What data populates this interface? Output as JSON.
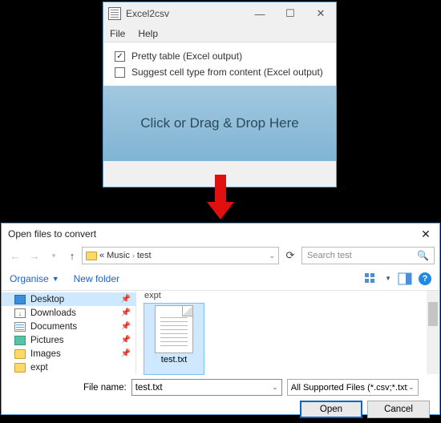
{
  "app": {
    "title": "Excel2csv",
    "menu": {
      "file": "File",
      "help": "Help"
    },
    "opts": {
      "pretty": {
        "label": "Pretty table (Excel output)",
        "checked": true
      },
      "suggest": {
        "label": "Suggest cell type from content (Excel output)",
        "checked": false
      }
    },
    "drop_zone": "Click or Drag & Drop Here"
  },
  "dialog": {
    "title": "Open files to convert",
    "path": {
      "prefix": "«",
      "seg1": "Music",
      "seg2": "test"
    },
    "search_placeholder": "Search test",
    "toolbar": {
      "organise": "Organise",
      "new_folder": "New folder"
    },
    "sidebar": [
      {
        "label": "Desktop",
        "icon": "desktop",
        "pinned": true
      },
      {
        "label": "Downloads",
        "icon": "downloads",
        "pinned": true
      },
      {
        "label": "Documents",
        "icon": "documents",
        "pinned": true
      },
      {
        "label": "Pictures",
        "icon": "pictures",
        "pinned": true
      },
      {
        "label": "Images",
        "icon": "folder",
        "pinned": true
      },
      {
        "label": "expt",
        "icon": "folder",
        "pinned": false
      }
    ],
    "files": {
      "header": "expt",
      "items": [
        {
          "name": "test.txt",
          "selected": true
        }
      ]
    },
    "file_name_label": "File name:",
    "file_name_value": "test.txt",
    "filter": "All Supported Files (*.csv;*.txt;*.",
    "buttons": {
      "open": "Open",
      "cancel": "Cancel"
    }
  }
}
